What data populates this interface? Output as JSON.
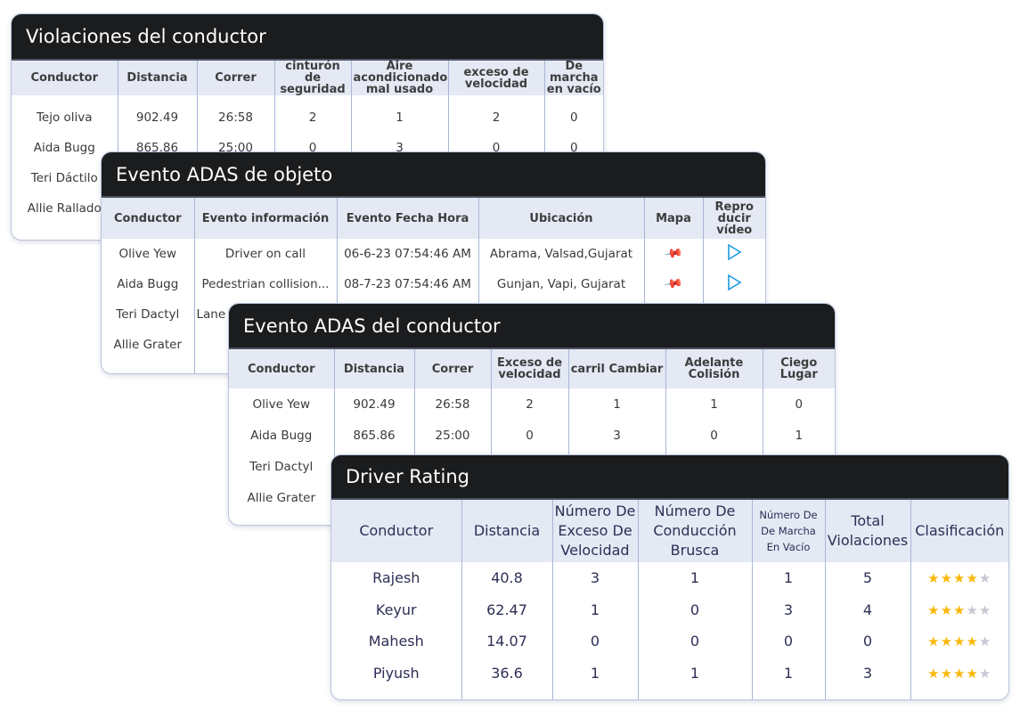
{
  "violations": {
    "title": "Violaciones del conductor",
    "headers": [
      "Conductor",
      "Distancia",
      "Correr",
      "cinturón de seguridad",
      "Aire acondicionado mal usado",
      "exceso de velocidad",
      "De marcha en vacío"
    ],
    "rows": [
      [
        "Tejo oliva",
        "902.49",
        "26:58",
        "2",
        "1",
        "2",
        "0"
      ],
      [
        "Aida Bugg",
        "865.86",
        "25:00",
        "0",
        "3",
        "0",
        "0"
      ],
      [
        "Teri Dáctilo",
        "",
        "",
        "",
        "",
        "",
        ""
      ],
      [
        "Allie Rallado",
        "",
        "",
        "",
        "",
        "",
        ""
      ]
    ]
  },
  "object_adas": {
    "title": "Evento ADAS de objeto",
    "headers": [
      "Conductor",
      "Evento información",
      "Evento Fecha Hora",
      "Ubicación",
      "Mapa",
      "Repro ducir vídeo"
    ],
    "rows": [
      {
        "driver": "Olive Yew",
        "event": "Driver on call",
        "datetime": "06-6-23  07:54:46 AM",
        "location": "Abrama, Valsad,Gujarat",
        "map_icon": "map-pin-icon",
        "video_icon": "play-icon"
      },
      {
        "driver": "Aida Bugg",
        "event": "Pedestrian collision...",
        "datetime": "08-7-23  07:54:46 AM",
        "location": "Gunjan, Vapi, Gujarat",
        "map_icon": "map-pin-icon",
        "video_icon": "play-icon"
      },
      {
        "driver": "Teri Dactyl",
        "event": "Lane",
        "datetime": "",
        "location": "",
        "map_icon": "",
        "video_icon": ""
      },
      {
        "driver": "Allie Grater",
        "event": "",
        "datetime": "",
        "location": "",
        "map_icon": "",
        "video_icon": ""
      }
    ],
    "colors": {
      "pin": "#6cc33a",
      "play": "#1e9be0"
    }
  },
  "driver_adas": {
    "title": "Evento ADAS del conductor",
    "headers": [
      "Conductor",
      "Distancia",
      "Correr",
      "Exceso de velocidad",
      "carril Cambiar",
      "Adelante Colisión",
      "Ciego Lugar"
    ],
    "rows": [
      [
        "Olive Yew",
        "902.49",
        "26:58",
        "2",
        "1",
        "1",
        "0"
      ],
      [
        "Aida Bugg",
        "865.86",
        "25:00",
        "0",
        "3",
        "0",
        "1"
      ],
      [
        "Teri Dactyl",
        "",
        "",
        "",
        "",
        "",
        ""
      ],
      [
        "Allie Grater",
        "",
        "",
        "",
        "",
        "",
        ""
      ]
    ]
  },
  "rating": {
    "title": "Driver Rating",
    "headers": [
      "Conductor",
      "Distancia",
      "Número De Exceso De Velocidad",
      "Número De Conducción Brusca",
      "Número De De Marcha En Vacío",
      "Total Violaciones",
      "Clasificación"
    ],
    "rows": [
      {
        "driver": "Rajesh",
        "distance": "40.8",
        "speeding": "3",
        "harsh": "1",
        "idle": "1",
        "total": "5",
        "stars": 4
      },
      {
        "driver": "Keyur",
        "distance": "62.47",
        "speeding": "1",
        "harsh": "0",
        "idle": "3",
        "total": "4",
        "stars": 3
      },
      {
        "driver": "Mahesh",
        "distance": "14.07",
        "speeding": "0",
        "harsh": "0",
        "idle": "0",
        "total": "0",
        "stars": 4
      },
      {
        "driver": "Piyush",
        "distance": "36.6",
        "speeding": "1",
        "harsh": "1",
        "idle": "1",
        "total": "3",
        "stars": 4
      }
    ],
    "max_stars": 5,
    "colors": {
      "star_on": "#f8b80c",
      "star_off": "#c6c8d2"
    }
  }
}
